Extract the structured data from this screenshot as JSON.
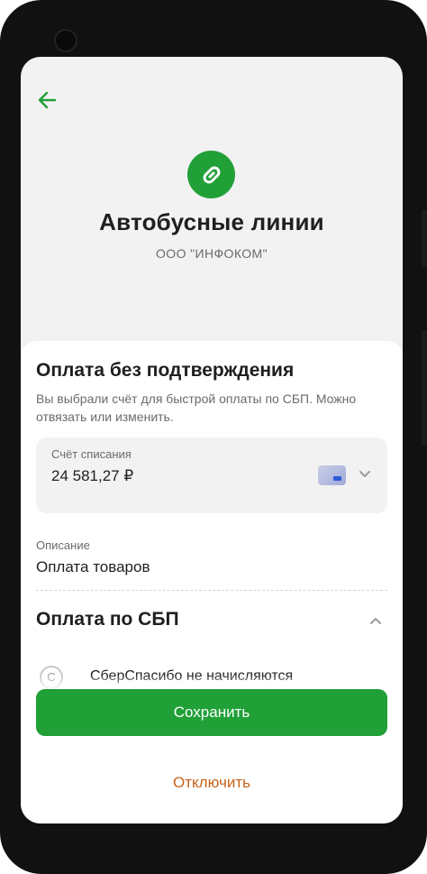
{
  "header": {
    "merchant_name": "Автобусные линии",
    "merchant_company": "ООО \"ИНФОКОМ\"",
    "logo_icon": "link-icon",
    "back_icon": "arrow-left-icon"
  },
  "sheet": {
    "title": "Оплата без подтверждения",
    "description": "Вы выбрали счёт для быстрой оплаты по СБП. Можно отвязать или изменить.",
    "account": {
      "label": "Счёт списания",
      "amount": "24 581,27 ₽",
      "card_icon": "bank-card-icon",
      "chevron_icon": "chevron-down-icon"
    },
    "description_field": {
      "label": "Описание",
      "value": "Оплата товаров"
    },
    "sbp_section": {
      "title": "Оплата по СБП",
      "chevron_icon": "chevron-up-icon",
      "bonus_text": "СберСпасибо не начисляются",
      "bonus_icon": "spasibo-icon"
    },
    "save_label": "Сохранить",
    "disable_label": "Отключить"
  },
  "colors": {
    "accent": "#21a038",
    "danger_text": "#c9631a",
    "background": "#f2f2f2"
  }
}
